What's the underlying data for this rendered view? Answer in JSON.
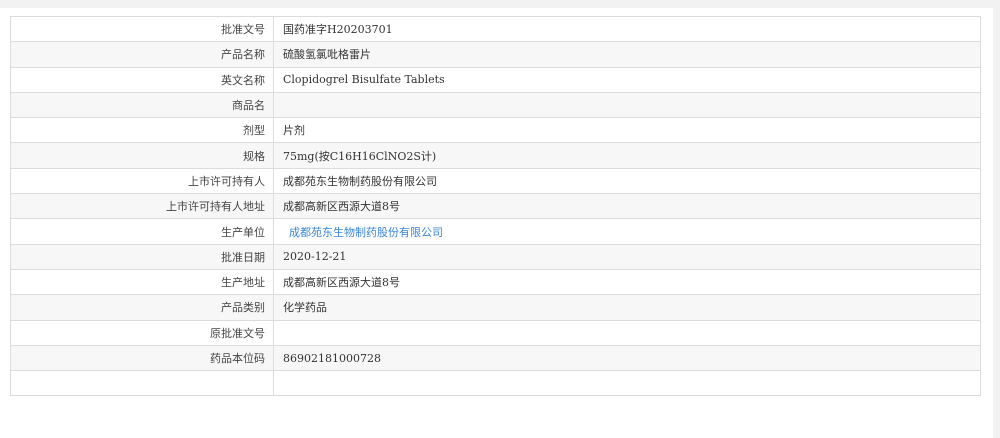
{
  "rows": [
    {
      "label": "批准文号",
      "value": "国药准字H20203701"
    },
    {
      "label": "产品名称",
      "value": "硫酸氢氯吡格雷片"
    },
    {
      "label": "英文名称",
      "value": "Clopidogrel Bisulfate Tablets"
    },
    {
      "label": "商品名",
      "value": ""
    },
    {
      "label": "剂型",
      "value": "片剂"
    },
    {
      "label": "规格",
      "value": "75mg(按C16H16ClNO2S计)"
    },
    {
      "label": "上市许可持有人",
      "value": "成都苑东生物制药股份有限公司"
    },
    {
      "label": "上市许可持有人地址",
      "value": "成都高新区西源大道8号"
    },
    {
      "label": "生产单位",
      "value": "成都苑东生物制药股份有限公司"
    },
    {
      "label": "批准日期",
      "value": "2020-12-21"
    },
    {
      "label": "生产地址",
      "value": "成都高新区西源大道8号"
    },
    {
      "label": "产品类别",
      "value": "化学药品"
    },
    {
      "label": "原批准文号",
      "value": ""
    },
    {
      "label": "药品本位码",
      "value": "86902181000728"
    },
    {
      "label": "",
      "value": ""
    }
  ],
  "colors": {
    "link": "#3a86d6",
    "border": "#dcdcdc",
    "row_alt": "#f7f7f7",
    "page_bg": "#f2f2f2"
  }
}
